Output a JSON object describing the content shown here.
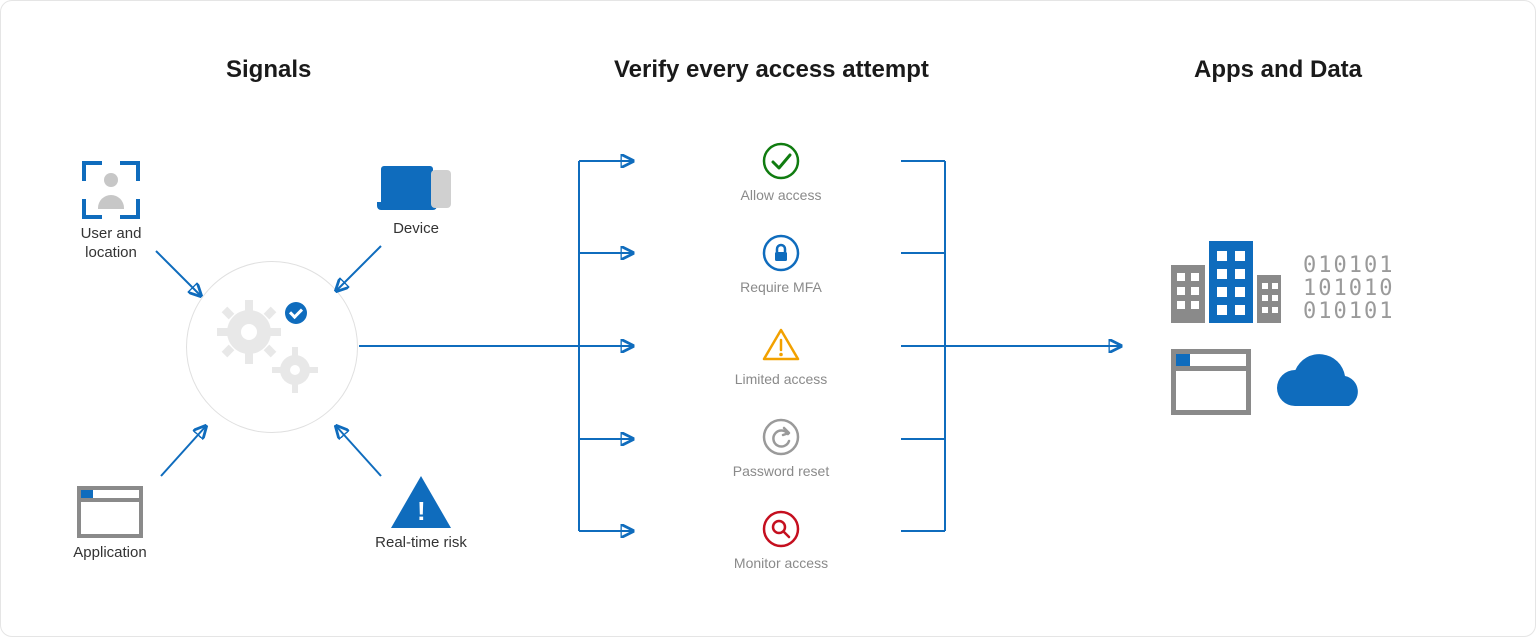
{
  "columns": {
    "signals": {
      "title": "Signals"
    },
    "verify": {
      "title": "Verify every access attempt"
    },
    "apps": {
      "title": "Apps and Data"
    }
  },
  "signals": {
    "items": [
      {
        "id": "user-location",
        "label": "User and\nlocation"
      },
      {
        "id": "device",
        "label": "Device"
      },
      {
        "id": "application",
        "label": "Application"
      },
      {
        "id": "real-time-risk",
        "label": "Real-time risk"
      }
    ],
    "hub": {
      "description": "Conditional access policy engine"
    }
  },
  "outcomes": [
    {
      "id": "allow-access",
      "label": "Allow access",
      "icon": "checkmark-circle",
      "color": "#107c10"
    },
    {
      "id": "require-mfa",
      "label": "Require MFA",
      "icon": "lock-circle",
      "color": "#0f6cbd"
    },
    {
      "id": "limited-access",
      "label": "Limited access",
      "icon": "warning-triangle",
      "color": "#f2a100"
    },
    {
      "id": "password-reset",
      "label": "Password reset",
      "icon": "refresh-circle",
      "color": "#9a9a9a"
    },
    {
      "id": "monitor-access",
      "label": "Monitor access",
      "icon": "magnifier-circle",
      "color": "#c50f1f"
    }
  ],
  "apps_and_data": {
    "binary_rows": [
      "010101",
      "101010",
      "010101"
    ],
    "icons": [
      "buildings",
      "binary-data",
      "application-window",
      "cloud"
    ]
  },
  "palette": {
    "azure_blue": "#0f6cbd",
    "success_green": "#107c10",
    "warning_orange": "#f2a100",
    "danger_red": "#c50f1f",
    "muted_gray": "#9a9a9a"
  },
  "diagram": {
    "type": "flow",
    "description": "Signals feed a central conditional-access policy engine which evaluates every access attempt, producing one of several outcomes, and ultimately gates access to apps and data.",
    "flow": [
      "Signals",
      "Verify every access attempt",
      "Apps and Data"
    ]
  }
}
